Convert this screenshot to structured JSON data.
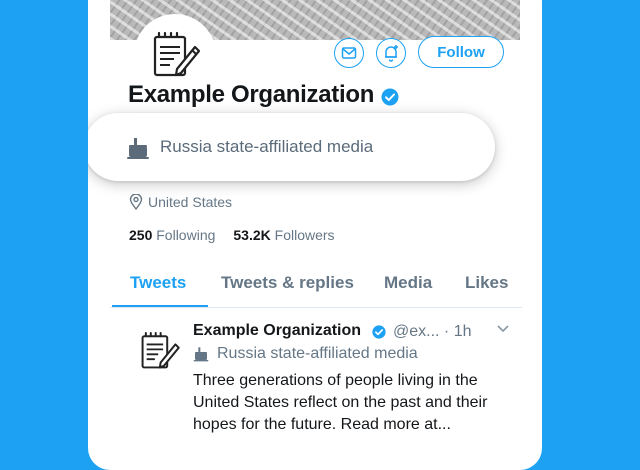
{
  "profile": {
    "name": "Example Organization",
    "follow_label": "Follow",
    "state_label": "Russia state-affiliated media",
    "location": "United States",
    "following_count": "250",
    "following_label": "Following",
    "followers_count": "53.2K",
    "followers_label": "Followers"
  },
  "tabs": [
    {
      "label": "Tweets",
      "active": true
    },
    {
      "label": "Tweets & replies",
      "active": false
    },
    {
      "label": "Media",
      "active": false
    },
    {
      "label": "Likes",
      "active": false
    }
  ],
  "tweet": {
    "name": "Example Organization",
    "handle_time": "@ex... · 1h",
    "label": "Russia state-affiliated media",
    "text": "Three generations of people living in the United States reflect on the past and their hopes for the future. Read more at..."
  },
  "icons": {
    "avatar": "notepad-pen-icon",
    "verified": "verified-badge-icon",
    "message": "envelope-icon",
    "notify": "bell-plus-icon",
    "state_media": "podium-icon",
    "location": "location-pin-icon",
    "more": "chevron-down-icon"
  },
  "colors": {
    "accent": "#1da1f2",
    "secondary_text": "#657786",
    "background": "#1da1f2"
  }
}
